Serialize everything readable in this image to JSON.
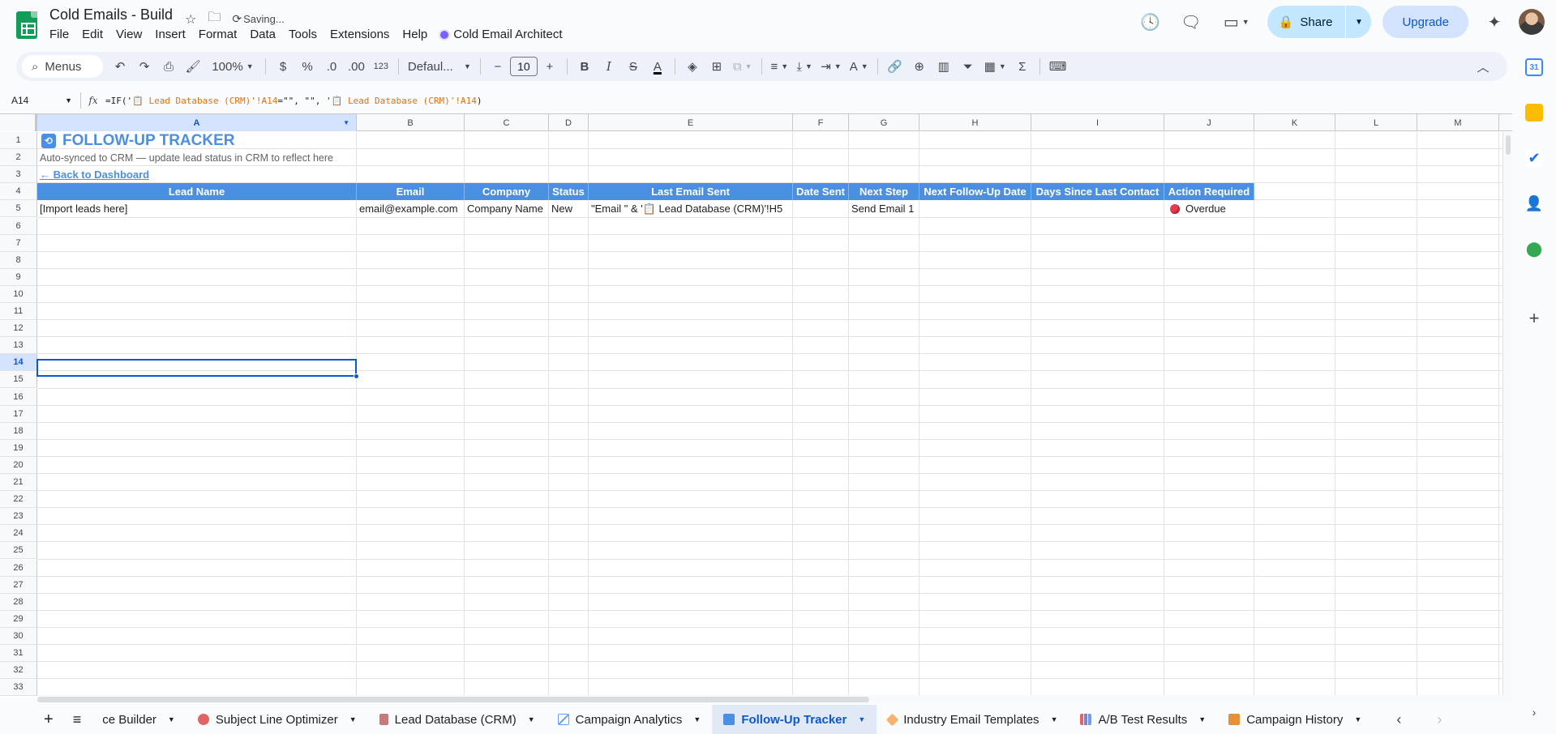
{
  "doc": {
    "title": "Cold Emails - Build",
    "status": "Saving..."
  },
  "menu": [
    "File",
    "Edit",
    "View",
    "Insert",
    "Format",
    "Data",
    "Tools",
    "Extensions",
    "Help"
  ],
  "extension": "Cold Email Architect",
  "actions": {
    "share": "Share",
    "upgrade": "Upgrade"
  },
  "toolbar": {
    "search": "Menus",
    "zoom": "100%",
    "currency": "$",
    "percent": "%",
    "dec_less": ".0",
    "dec_more": ".00",
    "number_format": "123",
    "font": "Defaul...",
    "font_size": "10"
  },
  "formula_bar": {
    "cell_ref": "A14",
    "parts": [
      "=IF('",
      "📋 Lead Database (CRM)'!A14",
      "=\"\", \"\", '",
      "📋 Lead Database (CRM)'!A14",
      ")"
    ]
  },
  "columns": [
    "A",
    "B",
    "C",
    "D",
    "E",
    "F",
    "G",
    "H",
    "I",
    "J",
    "K",
    "L",
    "M"
  ],
  "rows": [
    "1",
    "2",
    "3",
    "4",
    "5",
    "6",
    "7",
    "8",
    "9",
    "10",
    "11",
    "12",
    "13",
    "14",
    "15",
    "16",
    "17",
    "18",
    "19",
    "20",
    "21",
    "22",
    "23",
    "24",
    "25",
    "26",
    "27",
    "28",
    "29",
    "30",
    "31",
    "32",
    "33"
  ],
  "sheet": {
    "title": "FOLLOW-UP TRACKER",
    "subtitle": "Auto-synced to CRM — update lead status in CRM to reflect here",
    "back_link": "← Back to Dashboard",
    "headers": [
      "Lead Name",
      "Email",
      "Company",
      "Status",
      "Last Email Sent",
      "Date Sent",
      "Next Step",
      "Next Follow-Up Date",
      "Days Since Last Contact",
      "Action Required"
    ],
    "row5": [
      "[Import leads here]",
      "email@example.com",
      "Company Name",
      "New",
      "\"Email \" & '📋 Lead Database (CRM)'!H5",
      "",
      "Send Email 1",
      "",
      "",
      "Overdue"
    ]
  },
  "tabs": [
    {
      "label": "ce Builder",
      "icon_color": "",
      "active": false
    },
    {
      "label": "Subject Line Optimizer",
      "icon_color": "#e06666",
      "active": false
    },
    {
      "label": "Lead Database (CRM)",
      "icon_color": "#c27c7c",
      "active": false
    },
    {
      "label": "Campaign Analytics",
      "icon_color": "#6d9eeb",
      "active": false
    },
    {
      "label": "Follow-Up Tracker",
      "icon_color": "#4a90e2",
      "active": true
    },
    {
      "label": "Industry Email Templates",
      "icon_color": "#f6b26b",
      "active": false
    },
    {
      "label": "A/B Test Results",
      "icon_color": "#8e7cc3",
      "active": false
    },
    {
      "label": "Campaign History",
      "icon_color": "#e69138",
      "active": false
    }
  ],
  "side_panel": {
    "calendar": "31"
  },
  "colors": {
    "header_blue": "#4a90e2",
    "selection": "#0b57d0",
    "overdue_red": "#e53950"
  }
}
